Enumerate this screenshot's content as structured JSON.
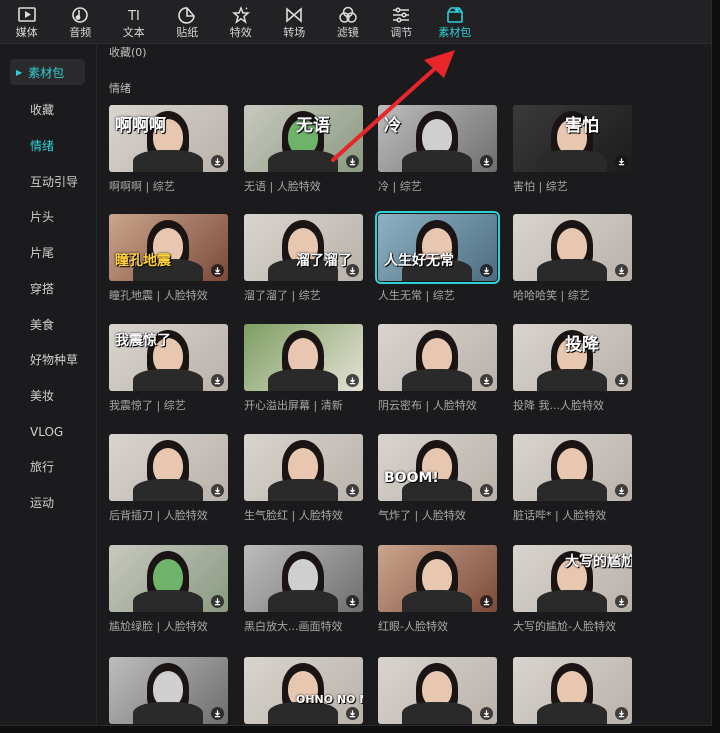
{
  "toolbar": {
    "tools": [
      {
        "label": "媒体",
        "icon": "media-icon"
      },
      {
        "label": "音频",
        "icon": "audio-icon"
      },
      {
        "label": "文本",
        "icon": "text-icon"
      },
      {
        "label": "贴纸",
        "icon": "sticker-icon"
      },
      {
        "label": "特效",
        "icon": "effects-icon"
      },
      {
        "label": "转场",
        "icon": "transition-icon"
      },
      {
        "label": "滤镜",
        "icon": "filter-icon"
      },
      {
        "label": "调节",
        "icon": "adjust-icon"
      },
      {
        "label": "素材包",
        "icon": "package-icon",
        "active": true
      }
    ],
    "text_icon_glyph": "TI"
  },
  "sidebar": {
    "header": "素材包",
    "items": [
      {
        "label": "收藏"
      },
      {
        "label": "情绪",
        "active": true
      },
      {
        "label": "互动引导"
      },
      {
        "label": "片头"
      },
      {
        "label": "片尾"
      },
      {
        "label": "穿搭"
      },
      {
        "label": "美食"
      },
      {
        "label": "好物种草"
      },
      {
        "label": "美妆"
      },
      {
        "label": "VLOG"
      },
      {
        "label": "旅行"
      },
      {
        "label": "运动"
      }
    ]
  },
  "content": {
    "favorites_label": "收藏(0)",
    "section_label": "情绪",
    "cards": [
      {
        "caption": "啊啊啊 | 综艺",
        "sticker": "啊啊啊",
        "theme": "light"
      },
      {
        "caption": "无语 | 人脸特效",
        "sticker": "无语",
        "theme": "green"
      },
      {
        "caption": "冷 | 综艺",
        "sticker": "冷",
        "theme": "gray"
      },
      {
        "caption": "害怕 | 综艺",
        "sticker": "害怕",
        "theme": "dark"
      },
      {
        "caption": "瞳孔地震 | 人脸特效",
        "sticker": "瞳孔地震",
        "theme": "warm"
      },
      {
        "caption": "溜了溜了 | 综艺",
        "sticker": "溜了溜了",
        "theme": "light"
      },
      {
        "caption": "人生无常 | 综艺",
        "sticker": "人生好无常",
        "theme": "blue",
        "selected": true
      },
      {
        "caption": "哈哈哈笑 | 综艺",
        "sticker": "",
        "theme": "light"
      },
      {
        "caption": "我震惊了 | 综艺",
        "sticker": "我震惊了",
        "theme": "light"
      },
      {
        "caption": "开心溢出屏幕 | 清新",
        "sticker": "",
        "theme": "outdoor"
      },
      {
        "caption": "阴云密布 | 人脸特效",
        "sticker": "",
        "theme": "light"
      },
      {
        "caption": "投降 我...人脸特效",
        "sticker": "投降",
        "theme": "light"
      },
      {
        "caption": "后背插刀 | 人脸特效",
        "sticker": "",
        "theme": "light"
      },
      {
        "caption": "生气脸红 | 人脸特效",
        "sticker": "",
        "theme": "light"
      },
      {
        "caption": "气炸了 | 人脸特效",
        "sticker": "BOOM!",
        "theme": "light"
      },
      {
        "caption": "脏话哔* | 人脸特效",
        "sticker": "",
        "theme": "light"
      },
      {
        "caption": "尴尬绿脸 | 人脸特效",
        "sticker": "",
        "theme": "green"
      },
      {
        "caption": "黑白放大...画面特效",
        "sticker": "",
        "theme": "gray"
      },
      {
        "caption": "红眼-人脸特效",
        "sticker": "",
        "theme": "warm"
      },
      {
        "caption": "大写的尴尬-人脸特效",
        "sticker": "大写的尴尬",
        "theme": "light"
      },
      {
        "caption": "",
        "sticker": "",
        "theme": "gray"
      },
      {
        "caption": "",
        "sticker": "OHNO NO NO",
        "theme": "light"
      },
      {
        "caption": "",
        "sticker": "",
        "theme": "light"
      },
      {
        "caption": "",
        "sticker": "",
        "theme": "light"
      }
    ]
  },
  "colors": {
    "accent": "#2fd0d8",
    "arrow": "#e8252a",
    "background": "#1b1b1d",
    "toolbar": "#222225"
  }
}
